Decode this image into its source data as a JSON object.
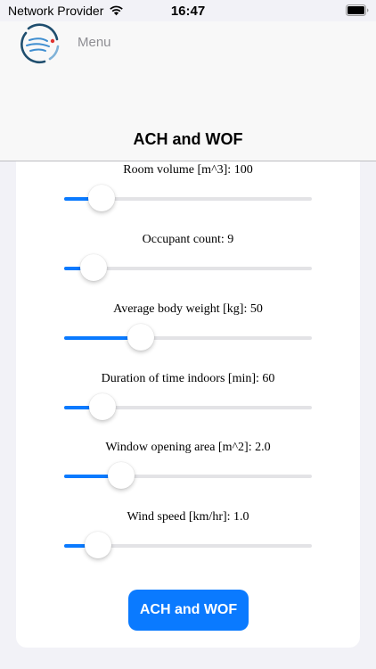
{
  "status_bar": {
    "carrier": "Network Provider",
    "time": "16:47"
  },
  "header": {
    "menu_label": "Menu",
    "title": "ACH and WOF"
  },
  "colors": {
    "accent": "#0a7aff",
    "track": "#e3e3e6",
    "background": "#f2f2f7"
  },
  "sliders": [
    {
      "label": "Room volume [m^3]: 100",
      "fraction": 0.15
    },
    {
      "label": "Occupant count: 9",
      "fraction": 0.12
    },
    {
      "label": "Average body weight [kg]: 50",
      "fraction": 0.31
    },
    {
      "label": "Duration of time indoors [min]: 60",
      "fraction": 0.155
    },
    {
      "label": "Window opening area [m^2]: 2.0",
      "fraction": 0.23
    },
    {
      "label": "Wind speed [km/hr]: 1.0",
      "fraction": 0.135
    }
  ],
  "button": {
    "label": "ACH and WOF"
  }
}
